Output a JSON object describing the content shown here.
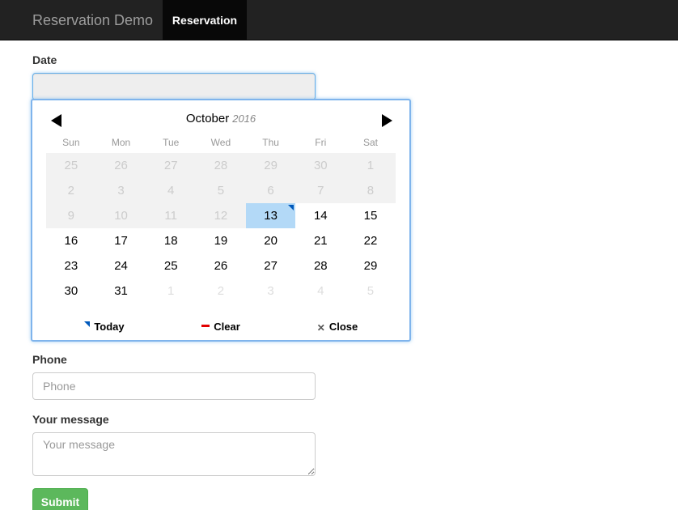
{
  "navbar": {
    "brand": "Reservation Demo",
    "active_item": "Reservation"
  },
  "form": {
    "date_label": "Date",
    "date_value": "",
    "phone_label": "Phone",
    "phone_placeholder": "Phone",
    "message_label": "Your message",
    "message_placeholder": "Your message",
    "submit_label": "Submit"
  },
  "picker": {
    "month": "October",
    "year": "2016",
    "weekdays": [
      "Sun",
      "Mon",
      "Tue",
      "Wed",
      "Thu",
      "Fri",
      "Sat"
    ],
    "weeks": [
      [
        {
          "d": "25",
          "s": "disabled"
        },
        {
          "d": "26",
          "s": "disabled"
        },
        {
          "d": "27",
          "s": "disabled"
        },
        {
          "d": "28",
          "s": "disabled"
        },
        {
          "d": "29",
          "s": "disabled"
        },
        {
          "d": "30",
          "s": "disabled"
        },
        {
          "d": "1",
          "s": "disabled"
        }
      ],
      [
        {
          "d": "2",
          "s": "disabled"
        },
        {
          "d": "3",
          "s": "disabled"
        },
        {
          "d": "4",
          "s": "disabled"
        },
        {
          "d": "5",
          "s": "disabled"
        },
        {
          "d": "6",
          "s": "disabled"
        },
        {
          "d": "7",
          "s": "disabled"
        },
        {
          "d": "8",
          "s": "disabled"
        }
      ],
      [
        {
          "d": "9",
          "s": "disabled"
        },
        {
          "d": "10",
          "s": "disabled"
        },
        {
          "d": "11",
          "s": "disabled"
        },
        {
          "d": "12",
          "s": "disabled"
        },
        {
          "d": "13",
          "s": "selected today"
        },
        {
          "d": "14",
          "s": ""
        },
        {
          "d": "15",
          "s": ""
        }
      ],
      [
        {
          "d": "16",
          "s": ""
        },
        {
          "d": "17",
          "s": ""
        },
        {
          "d": "18",
          "s": ""
        },
        {
          "d": "19",
          "s": ""
        },
        {
          "d": "20",
          "s": ""
        },
        {
          "d": "21",
          "s": ""
        },
        {
          "d": "22",
          "s": ""
        }
      ],
      [
        {
          "d": "23",
          "s": ""
        },
        {
          "d": "24",
          "s": ""
        },
        {
          "d": "25",
          "s": ""
        },
        {
          "d": "26",
          "s": ""
        },
        {
          "d": "27",
          "s": ""
        },
        {
          "d": "28",
          "s": ""
        },
        {
          "d": "29",
          "s": ""
        }
      ],
      [
        {
          "d": "30",
          "s": ""
        },
        {
          "d": "31",
          "s": ""
        },
        {
          "d": "1",
          "s": "other"
        },
        {
          "d": "2",
          "s": "other"
        },
        {
          "d": "3",
          "s": "other"
        },
        {
          "d": "4",
          "s": "other"
        },
        {
          "d": "5",
          "s": "other"
        }
      ]
    ],
    "footer": {
      "today": "Today",
      "clear": "Clear",
      "close": "Close"
    },
    "colors": {
      "selected": "#b3d9f7",
      "today_marker": "#0059bc",
      "clear_marker": "#e20000",
      "disabled": "#f2f2f2"
    }
  }
}
